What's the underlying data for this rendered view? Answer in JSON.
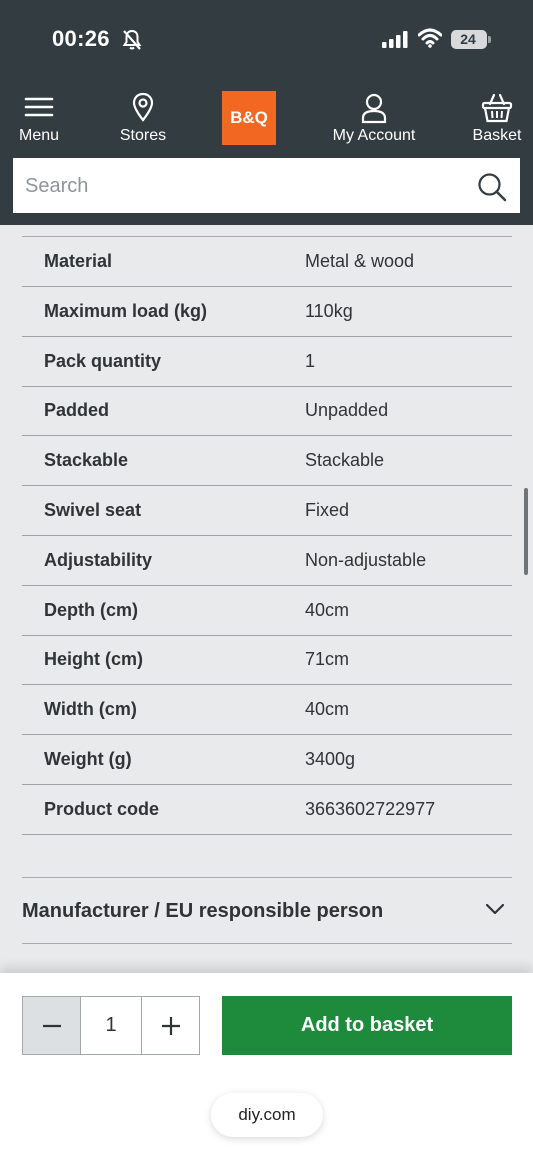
{
  "status_bar": {
    "time": "00:26",
    "battery": "24"
  },
  "nav": {
    "menu_label": "Menu",
    "stores_label": "Stores",
    "logo_text": "B&Q",
    "account_label": "My Account",
    "basket_label": "Basket"
  },
  "search": {
    "placeholder": "Search",
    "value": ""
  },
  "specs": [
    {
      "label": "Material",
      "value": "Metal & wood"
    },
    {
      "label": "Maximum load (kg)",
      "value": "110kg"
    },
    {
      "label": "Pack quantity",
      "value": "1"
    },
    {
      "label": "Padded",
      "value": "Unpadded"
    },
    {
      "label": "Stackable",
      "value": "Stackable"
    },
    {
      "label": "Swivel seat",
      "value": "Fixed"
    },
    {
      "label": "Adjustability",
      "value": "Non-adjustable"
    },
    {
      "label": "Depth (cm)",
      "value": "40cm"
    },
    {
      "label": "Height (cm)",
      "value": "71cm"
    },
    {
      "label": "Width (cm)",
      "value": "40cm"
    },
    {
      "label": "Weight (g)",
      "value": "3400g"
    },
    {
      "label": "Product code",
      "value": "3663602722977"
    }
  ],
  "accordion": {
    "title": "Manufacturer / EU responsible person"
  },
  "footer": {
    "quantity": "1",
    "add_to_basket_label": "Add to basket",
    "url": "diy.com"
  },
  "colors": {
    "header_bg": "#333c41",
    "brand_orange": "#f26722",
    "add_button_green": "#1d8a3c",
    "page_bg": "#e9eaec"
  },
  "icons": [
    "bell-muted-icon",
    "signal-icon",
    "wifi-icon",
    "menu-icon",
    "location-pin-icon",
    "user-icon",
    "basket-icon",
    "search-icon",
    "chevron-down-icon",
    "minus-icon",
    "plus-icon"
  ]
}
